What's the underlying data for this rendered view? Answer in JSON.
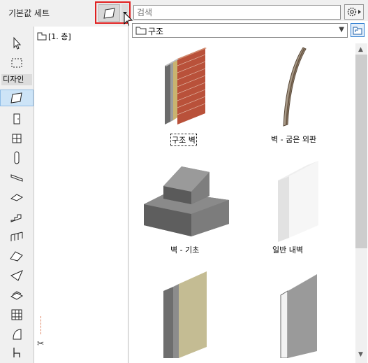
{
  "header": {
    "title": "기본값 세트",
    "search_placeholder": "검색"
  },
  "toolbox": {
    "section_label": "디자인"
  },
  "tree": {
    "items": [
      {
        "label": "[1. 층]"
      }
    ]
  },
  "browser": {
    "folder": "구조",
    "items": [
      {
        "label": "구조 벽",
        "selected": true
      },
      {
        "label": "벽 - 굽은 외판",
        "selected": false
      },
      {
        "label": "벽 - 기초",
        "selected": false
      },
      {
        "label": "일반 내벽",
        "selected": false
      }
    ]
  },
  "colors": {
    "highlight_border": "#e02020",
    "selection_bg": "#cde4f7",
    "accent": "#2a7bd0"
  }
}
